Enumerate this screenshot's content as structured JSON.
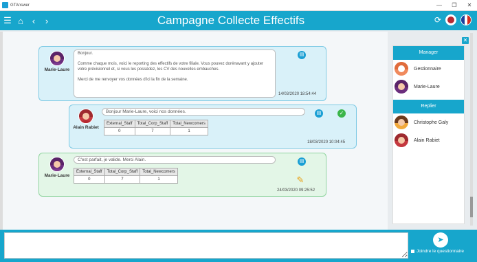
{
  "app": {
    "name": "GTAnswer"
  },
  "window": {
    "min": "—",
    "max": "❐",
    "close": "✕"
  },
  "nav": {
    "menu_icon": "hamburger-icon",
    "home_icon": "home-icon",
    "back_icon": "chevron-left-icon",
    "forward_icon": "chevron-right-icon",
    "title": "Campagne Collecte Effectifs"
  },
  "messages": [
    {
      "author": "Marie-Laure",
      "text": "Bonjour.\n\nComme chaque mois, voici le reporting des effectifs de votre filiale. Vous pouvez dorénavant y ajouter votre prévisionnel et, si vous les possédez, les CV des nouvelles embauches.\n\nMerci de me renvoyer vos données d'ici la fin de la semaine.",
      "timestamp": "14/03/2020 18:54:44"
    },
    {
      "author": "Alain Rabiet",
      "text": "Bonjour Marie-Laure, voici nos données.",
      "timestamp": "18/03/2020 10:04:45",
      "table": {
        "headers": [
          "External_Staff",
          "Total_Corp_Staff",
          "Total_Newcomers"
        ],
        "values": [
          "0",
          "7",
          "1"
        ]
      }
    },
    {
      "author": "Marie-Laure",
      "text": "C'est parfait, je valide. Merci Alain.",
      "timestamp": "24/03/2020 09:25:52",
      "table": {
        "headers": [
          "External_Staff",
          "Total_Corp_Staff",
          "Total_Newcomers"
        ],
        "values": [
          "0",
          "7",
          "1"
        ]
      }
    }
  ],
  "sidebar": {
    "manager_title": "Manager",
    "managers": [
      {
        "label": "Gestionnaire"
      },
      {
        "label": "Marie-Laure"
      }
    ],
    "reply_title": "Replier",
    "repliers": [
      {
        "label": "Christophe Galy"
      },
      {
        "label": "Alain Rabiet"
      }
    ]
  },
  "compose": {
    "placeholder": "",
    "join_label": "Joindre le questionnaire"
  },
  "colors": {
    "accent": "#17a6cc",
    "blue_bubble": "#d9f1f9",
    "green_bubble": "#e3f6e7"
  }
}
